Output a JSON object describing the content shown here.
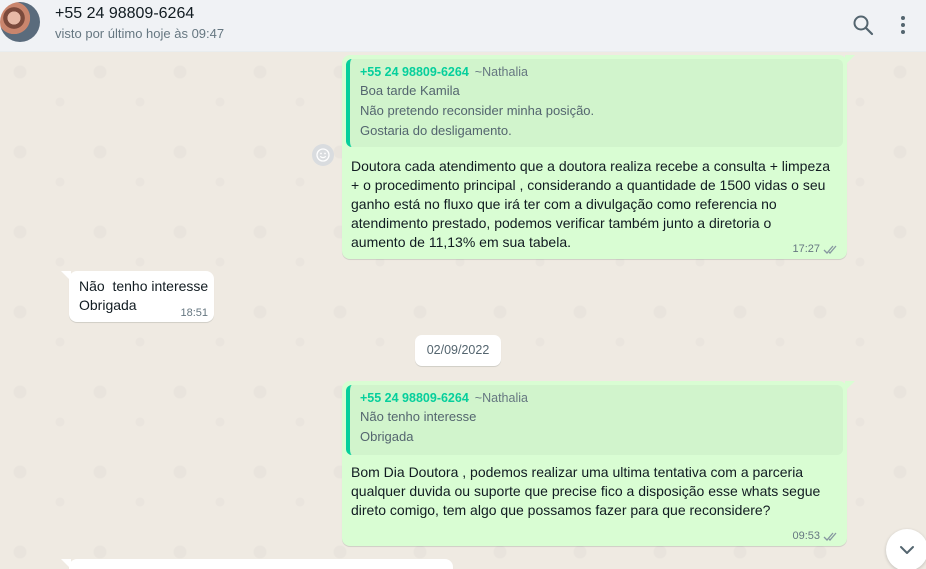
{
  "header": {
    "contact_name": "+55 24 98809-6264",
    "status": "visto por último hoje às 09:47",
    "icons": [
      "search-icon",
      "menu-icon"
    ]
  },
  "messages": [
    {
      "direction": "outgoing",
      "quote": {
        "author": "+55 24 98809-6264",
        "push_name": "~Nathalia",
        "lines": [
          "Boa tarde Kamila",
          "Não pretendo reconsider minha posição.",
          "Gostaria do desligamento."
        ]
      },
      "lines": [
        "Doutora cada atendimento que a doutora realiza recebe a consulta + limpeza",
        "+ o procedimento principal , considerando a quantidade de 1500 vidas o seu",
        "ganho está no fluxo que irá ter com a divulgação como referencia no",
        "atendimento prestado, podemos verificar também junto a diretoria o",
        "aumento de 11,13% em sua tabela."
      ],
      "time": "17:27",
      "status": "read"
    },
    {
      "direction": "incoming",
      "lines": [
        "Não  tenho interesse",
        "Obrigada"
      ],
      "time": "18:51"
    },
    {
      "direction": "outgoing",
      "quote": {
        "author": "+55 24 98809-6264",
        "push_name": "~Nathalia",
        "lines": [
          "Não  tenho interesse",
          "Obrigada"
        ]
      },
      "lines": [
        "Bom Dia Doutora , podemos realizar uma ultima tentativa com a parceria",
        "qualquer duvida ou suporte que precise fico a disposição esse whats segue",
        "direto comigo, tem algo que possamos fazer para que reconsidere?"
      ],
      "time": "09:53",
      "status": "read"
    }
  ],
  "date_divider": "02/09/2022",
  "colors": {
    "outgoing_bubble": "#d9fdd3",
    "quote_accent": "#06cf9c",
    "chat_background": "#efeae2"
  }
}
